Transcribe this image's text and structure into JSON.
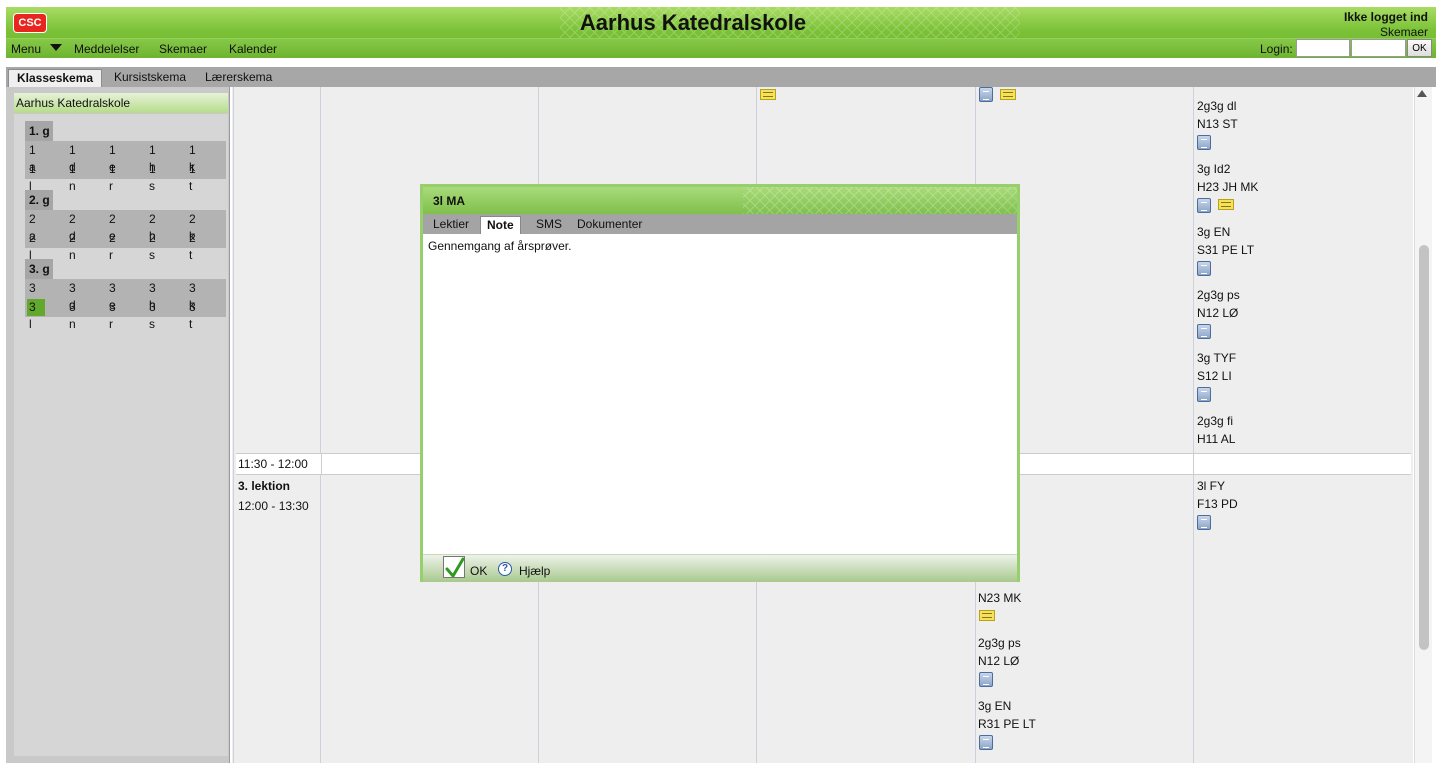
{
  "header": {
    "logo": "CSC",
    "title": "Aarhus Katedralskole",
    "login_status": "Ikke logget ind",
    "subtitle": "Skemaer",
    "nav": [
      "Menu",
      "Meddelelser",
      "Skemaer",
      "Kalender"
    ],
    "login_label": "Login:",
    "login_ok": "OK"
  },
  "tabs": [
    "Klasseskema",
    "Kursistskema",
    "Lærerskema"
  ],
  "sidebar": {
    "title": "Aarhus Katedralskole",
    "grades": [
      {
        "label": "1. g",
        "classes": [
          "1 a",
          "1 d",
          "1 e",
          "1 h",
          "1 k",
          "1 l",
          "1 n",
          "1 r",
          "1 s",
          "1 t"
        ]
      },
      {
        "label": "2. g",
        "classes": [
          "2 a",
          "2 d",
          "2 e",
          "2 h",
          "2 k",
          "2 l",
          "2 n",
          "2 r",
          "2 s",
          "2 t"
        ]
      },
      {
        "label": "3. g",
        "classes": [
          "3 a",
          "3 d",
          "3 e",
          "3 h",
          "3 k",
          "3 l",
          "3 n",
          "3 r",
          "3 s",
          "3 t"
        ]
      }
    ],
    "selected_class": "3 l"
  },
  "schedule": {
    "break_time": "11:30 - 12:00",
    "lesson3_label": "3. lektion",
    "lesson3_time": "12:00 - 13:30",
    "right_column_top": [
      {
        "line1": "2g3g dl",
        "line2": "N13 ST"
      },
      {
        "line1": "3g Id2",
        "line2": "H23 JH MK"
      },
      {
        "line1": "3g EN",
        "line2": "S31 PE LT"
      },
      {
        "line1": "2g3g ps",
        "line2": "N12 LØ"
      },
      {
        "line1": "3g TYF",
        "line2": "S12 LI"
      },
      {
        "line1": "2g3g fi",
        "line2": "H11 AL"
      }
    ],
    "right_column_bottom": {
      "line1": "3l FY",
      "line2": "F13 PD"
    },
    "col4_bottom": [
      {
        "line2": "N23 MK"
      },
      {
        "line1": "2g3g ps",
        "line2": "N12 LØ"
      },
      {
        "line1": "3g EN",
        "line2": "R31 PE LT"
      }
    ]
  },
  "dialog": {
    "title": "3l MA",
    "tabs": [
      "Lektier",
      "Note",
      "SMS",
      "Dokumenter"
    ],
    "active_tab": "Note",
    "text": "Gennemgang af årsprøver.",
    "ok_label": "OK",
    "help_label": "Hjælp"
  }
}
